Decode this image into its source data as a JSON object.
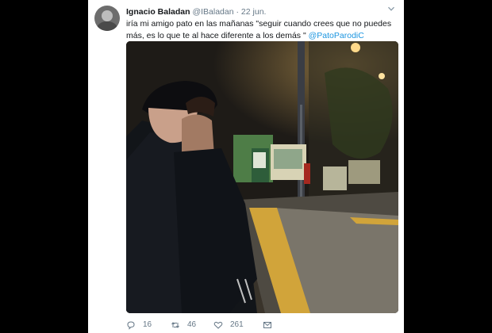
{
  "tweet": {
    "author_name": "Ignacio Baladan",
    "author_handle": "@IBaladan",
    "separator": "·",
    "date": "22 jun.",
    "text_line1": "iría mi amigo pato en las mañanas \"seguir cuando crees que no puedes",
    "text_line2": "más, es lo que te al hace diferente a los demás \"",
    "mention": "@PatoParodiC"
  },
  "actions": {
    "reply_count": "16",
    "retweet_count": "46",
    "like_count": "261"
  },
  "icons": {
    "chevron": "chevron-down-icon",
    "reply": "reply-icon",
    "retweet": "retweet-icon",
    "like": "heart-icon",
    "message": "message-icon"
  },
  "colors": {
    "name": "#14171a",
    "meta": "#657786",
    "link": "#1b95e0",
    "background": "#000000",
    "card": "#ffffff"
  }
}
